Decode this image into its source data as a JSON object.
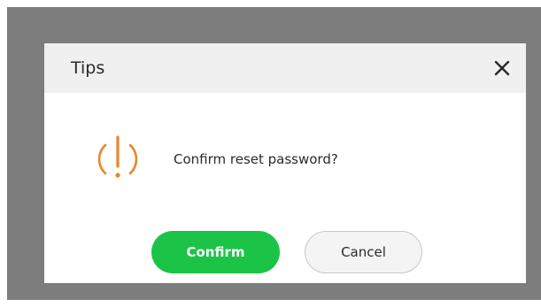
{
  "dialog": {
    "title": "Tips",
    "close_icon": "close-icon",
    "warning_icon": "exclamation-circle-icon",
    "message": "Confirm reset password?",
    "confirm_label": "Confirm",
    "cancel_label": "Cancel"
  },
  "colors": {
    "overlay": "#7d7d7d",
    "header_bg": "#f0f0f0",
    "warning": "#e8872a",
    "confirm_bg": "#1bc447",
    "cancel_bg": "#f4f4f4"
  }
}
